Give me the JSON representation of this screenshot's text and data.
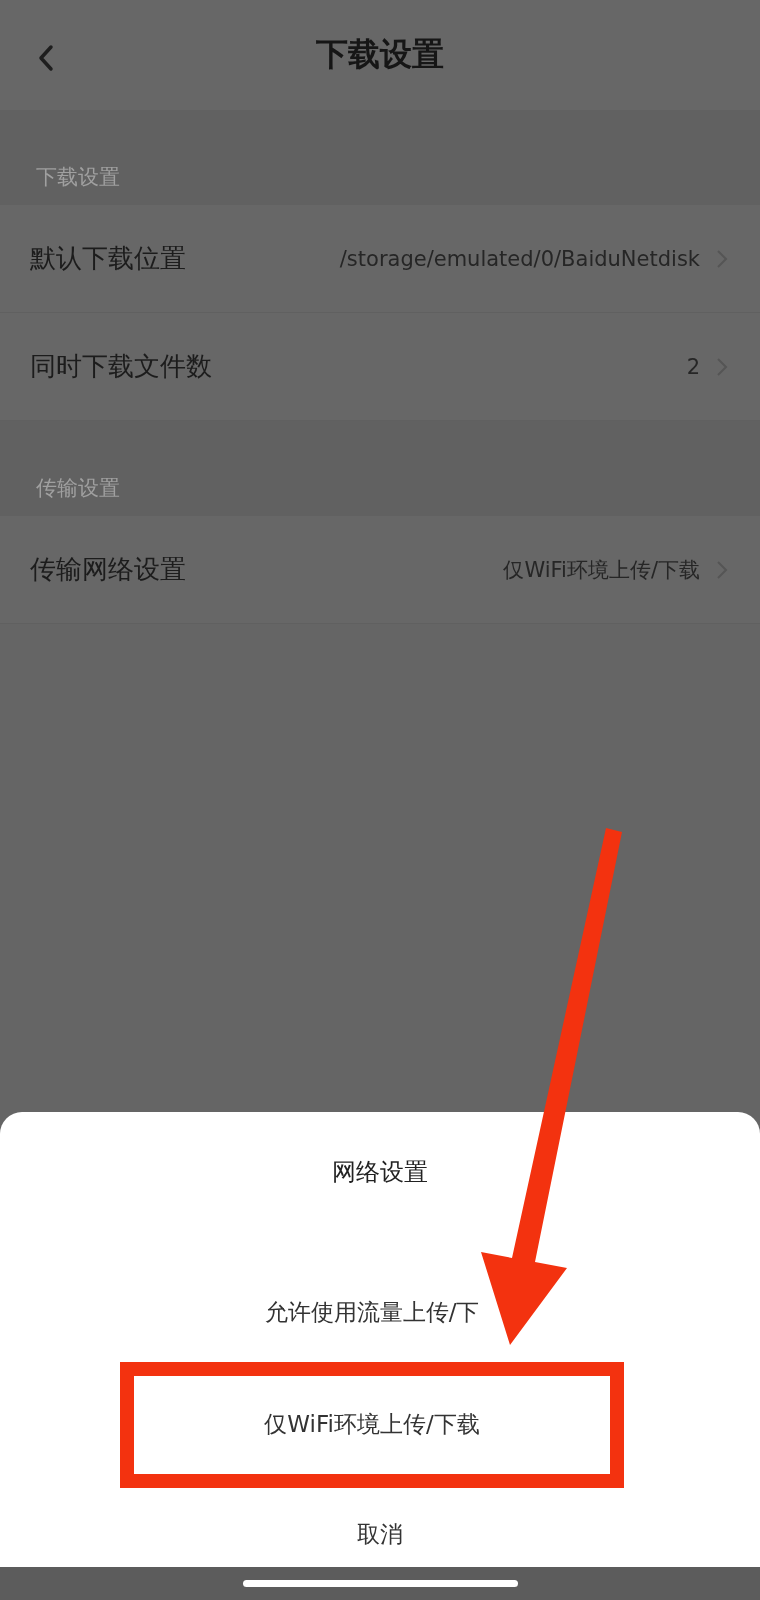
{
  "header": {
    "title": "下载设置"
  },
  "sections": [
    {
      "label": "下载设置",
      "rows": [
        {
          "label": "默认下载位置",
          "value": "/storage/emulated/0/BaiduNetdisk"
        },
        {
          "label": "同时下载文件数",
          "value": "2"
        }
      ]
    },
    {
      "label": "传输设置",
      "rows": [
        {
          "label": "传输网络设置",
          "value": "仅WiFi环境上传/下载"
        }
      ]
    }
  ],
  "sheet": {
    "title": "网络设置",
    "options": [
      {
        "label": "允许使用流量上传/下",
        "highlighted": false
      },
      {
        "label": "仅WiFi环境上传/下载",
        "highlighted": true
      }
    ],
    "cancel": "取消"
  }
}
